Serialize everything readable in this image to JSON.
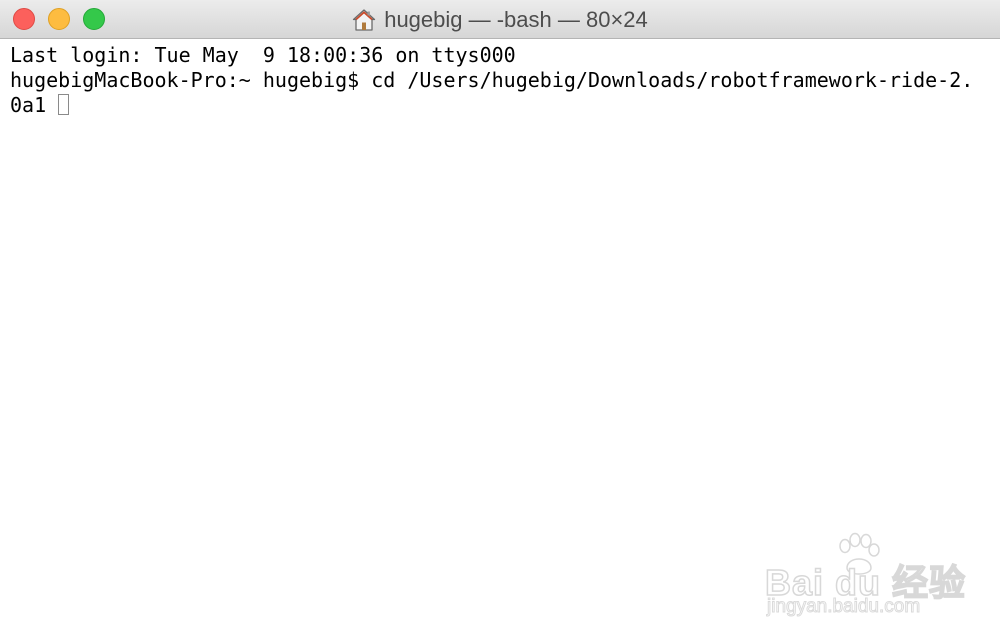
{
  "window": {
    "title": "hugebig — -bash — 80×24",
    "title_icon": "home-icon",
    "controls": [
      "close",
      "minimize",
      "zoom"
    ]
  },
  "terminal": {
    "lines": [
      "Last login: Tue May  9 18:00:36 on ttys000",
      "hugebigMacBook-Pro:~ hugebig$ cd /Users/hugebig/Downloads/robotframework-ride-2.",
      "0a1"
    ]
  },
  "watermark": {
    "brand": "Bai du 经验",
    "url": "jingyan.baidu.com"
  }
}
